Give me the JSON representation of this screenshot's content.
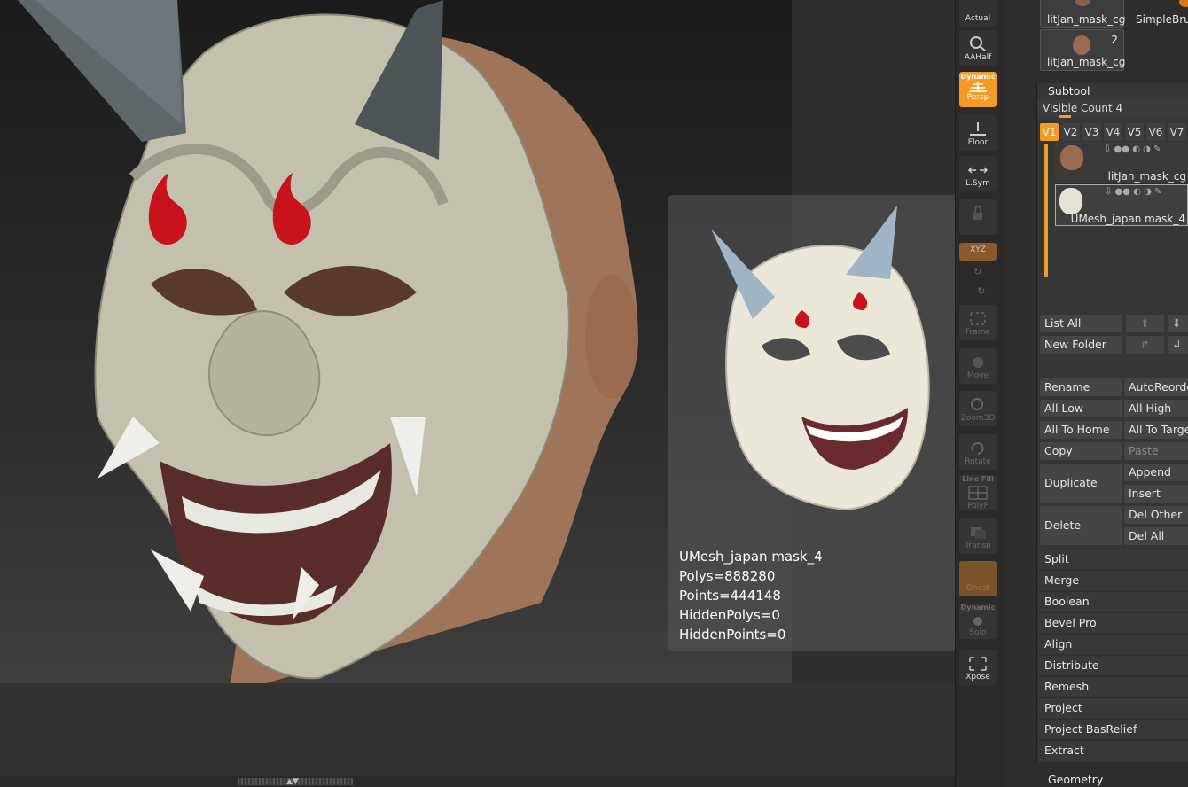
{
  "toolbar": {
    "actual": "Actual",
    "aahalf": "AAHalf",
    "persp_top": "Dynamic",
    "persp": "Persp",
    "floor": "Floor",
    "lsym": "L.Sym",
    "xyz": "XYZ",
    "frame": "Frame",
    "move": "Move",
    "zoom3d": "Zoom3D",
    "rotate": "Rotate",
    "linefill_top": "Line Fill",
    "polyf": "PolyF",
    "transp": "Transp",
    "ghost": "Ghost",
    "solo_top": "Dynamic",
    "solo": "Solo",
    "xpose": "Xpose"
  },
  "tool_thumbs": {
    "t1_label": "litJan_mask_cg",
    "t2_label": "SimpleBru",
    "t3_label": "litJan_mask_cg",
    "t3_count": "2"
  },
  "subtool": {
    "title": "Subtool",
    "visible_count": "Visible Count 4",
    "tabs": [
      "V1",
      "V2",
      "V3",
      "V4",
      "V5",
      "V6",
      "V7"
    ],
    "items": [
      {
        "name": "litJan_mask_cg"
      },
      {
        "name": "UMesh_japan mask_4"
      }
    ],
    "list_all": "List All",
    "new_folder": "New Folder",
    "rename": "Rename",
    "autoreorder": "AutoReorde",
    "all_low": "All Low",
    "all_high": "All High",
    "all_to_home": "All To Home",
    "all_to_target": "All To Targe",
    "copy": "Copy",
    "paste": "Paste",
    "duplicate": "Duplicate",
    "append": "Append",
    "insert": "Insert",
    "delete": "Delete",
    "del_other": "Del Other",
    "del_all": "Del All",
    "menus": [
      "Split",
      "Merge",
      "Boolean",
      "Bevel Pro",
      "Align",
      "Distribute",
      "Remesh",
      "Project",
      "Project BasRelief",
      "Extract"
    ],
    "geometry": "Geometry"
  },
  "popup": {
    "name": "UMesh_japan mask_4",
    "polys": "Polys=888280",
    "points": "Points=444148",
    "hidden_polys": "HiddenPolys=0",
    "hidden_points": "HiddenPoints=0"
  },
  "colors": {
    "accent": "#f59a23",
    "mask": "#c9c7b3",
    "horn": "#5d6468",
    "mark": "#c8121c"
  }
}
